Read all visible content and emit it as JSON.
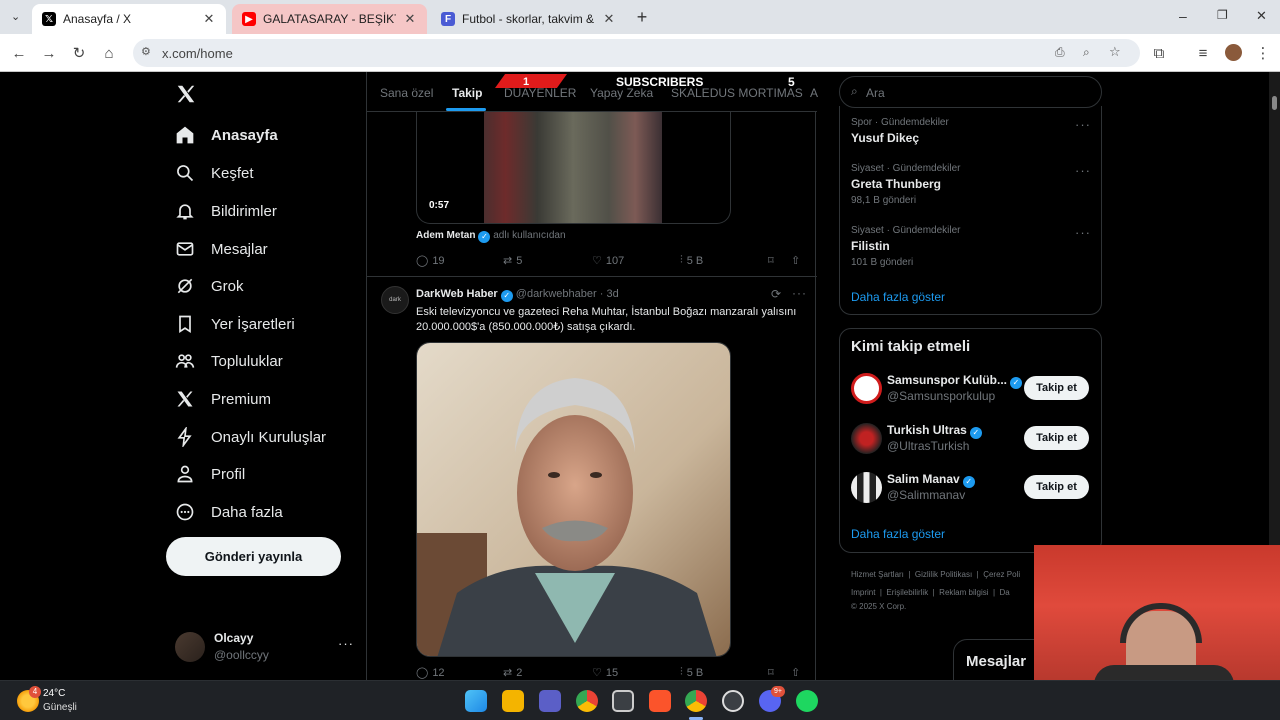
{
  "browser": {
    "tabs": [
      {
        "title": "Anasayfa / X",
        "favicon": "x-logo-icon"
      },
      {
        "title": "GALATASARAY - BEŞİKTAŞ MAÇ",
        "favicon": "youtube-icon"
      },
      {
        "title": "Futbol - skorlar, takvim & oranl",
        "favicon": "flashscore-icon"
      }
    ],
    "url": "x.com/home"
  },
  "sidebar": {
    "items": [
      {
        "label": "Anasayfa",
        "icon": "home-icon"
      },
      {
        "label": "Keşfet",
        "icon": "search-icon"
      },
      {
        "label": "Bildirimler",
        "icon": "bell-icon"
      },
      {
        "label": "Mesajlar",
        "icon": "mail-icon"
      },
      {
        "label": "Grok",
        "icon": "grok-icon"
      },
      {
        "label": "Yer İşaretleri",
        "icon": "bookmark-icon"
      },
      {
        "label": "Topluluklar",
        "icon": "communities-icon"
      },
      {
        "label": "Premium",
        "icon": "x-logo-icon"
      },
      {
        "label": "Onaylı Kuruluşlar",
        "icon": "lightning-icon"
      },
      {
        "label": "Profil",
        "icon": "person-icon"
      },
      {
        "label": "Daha fazla",
        "icon": "more-circle-icon"
      }
    ],
    "post_button": "Gönderi yayınla",
    "account": {
      "name": "Olcayy",
      "handle": "@oollccyy"
    }
  },
  "feed": {
    "tabs": [
      "Sana özel",
      "Takip",
      "DUAYENLER",
      "Yapay Zeka",
      "SKALEDUS MORTIMAS",
      "A"
    ],
    "active_tab": "Takip",
    "overlay": {
      "left_number": "1",
      "label": "SUBSCRIBERS",
      "right_number": "5"
    },
    "post1": {
      "video_duration": "0:57",
      "repost_by": "Adem Metan",
      "repost_suffix": "adlı kullanıcıdan",
      "stats": {
        "replies": "19",
        "reposts": "5",
        "likes": "107",
        "views": "5 B"
      }
    },
    "post2": {
      "author": "DarkWeb Haber",
      "handle": "@darkwebhaber",
      "time": "· 3d",
      "text_line1": "Eski televizyoncu ve gazeteci Reha Muhtar, İstanbul Boğazı manzaralı yalısını",
      "text_line2": "20.000.000$'a (850.000.000₺) satışa çıkardı.",
      "stats": {
        "replies": "12",
        "reposts": "2",
        "likes": "15",
        "views": "5 B"
      }
    }
  },
  "right": {
    "search_placeholder": "Ara",
    "trends": [
      {
        "category": "Spor · Gündemdekiler",
        "name": "Yusuf Dikeç",
        "posts": ""
      },
      {
        "category": "Siyaset · Gündemdekiler",
        "name": "Greta Thunberg",
        "posts": "98,1 B gönderi"
      },
      {
        "category": "Siyaset · Gündemdekiler",
        "name": "Filistin",
        "posts": "101 B gönderi"
      }
    ],
    "show_more": "Daha fazla göster",
    "who_to_follow": {
      "title": "Kimi takip etmeli",
      "users": [
        {
          "name": "Samsunspor Kulüb...",
          "handle": "@Samsunsporkulup",
          "button": "Takip et"
        },
        {
          "name": "Turkish Ultras",
          "handle": "@UltrasTurkish",
          "button": "Takip et"
        },
        {
          "name": "Salim Manav",
          "handle": "@Salimmanav",
          "button": "Takip et"
        }
      ],
      "show_more": "Daha fazla göster"
    },
    "footer": {
      "line1": [
        "Hizmet Şartları",
        "Gizlilik Politikası",
        "Çerez Poli"
      ],
      "line2": [
        "Imprint",
        "Erişilebilirlik",
        "Reklam bilgisi",
        "Da"
      ],
      "copyright": "© 2025 X Corp."
    },
    "messages_drawer": "Mesajlar"
  },
  "taskbar": {
    "weather_temp": "24°C",
    "weather_desc": "Güneşli",
    "weather_badge": "4",
    "discord_badge": "9+"
  },
  "colors": {
    "accent": "#1d9bf0",
    "background": "#000000",
    "border": "#2f3336"
  }
}
